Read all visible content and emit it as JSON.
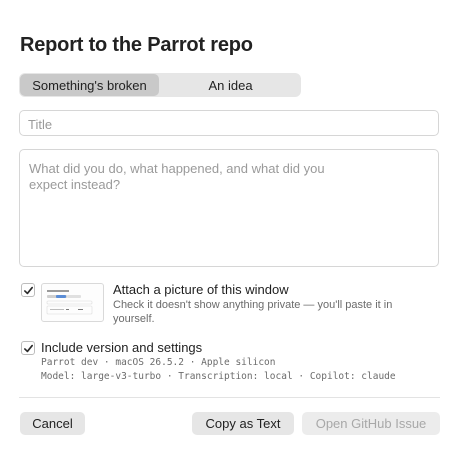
{
  "dialog": {
    "title": "Report to the Parrot repo"
  },
  "kind_selector": {
    "options": [
      {
        "label": "Something's broken",
        "selected": true
      },
      {
        "label": "An idea",
        "selected": false
      }
    ]
  },
  "form": {
    "title_placeholder": "Title",
    "body_placeholder": "What did you do, what happened, and what did you expect instead?"
  },
  "attach_screenshot": {
    "checked": true,
    "label": "Attach a picture of this window",
    "hint": "Check it doesn't show anything private — you'll paste it in yourself."
  },
  "include_settings": {
    "checked": true,
    "label": "Include version and settings",
    "details_line1": "Parrot dev · macOS 26.5.2 · Apple silicon",
    "details_line2": "Model: large-v3-turbo · Transcription: local · Copilot: claude"
  },
  "footer": {
    "cancel_label": "Cancel",
    "copy_label": "Copy as Text",
    "open_issue_label": "Open GitHub Issue",
    "open_issue_enabled": false
  },
  "colors": {
    "segment_bg": "#e6e6e6",
    "segment_active": "#c9c9c9",
    "button_bg": "#e6e6e6",
    "disabled_text": "#a8a8a8"
  }
}
